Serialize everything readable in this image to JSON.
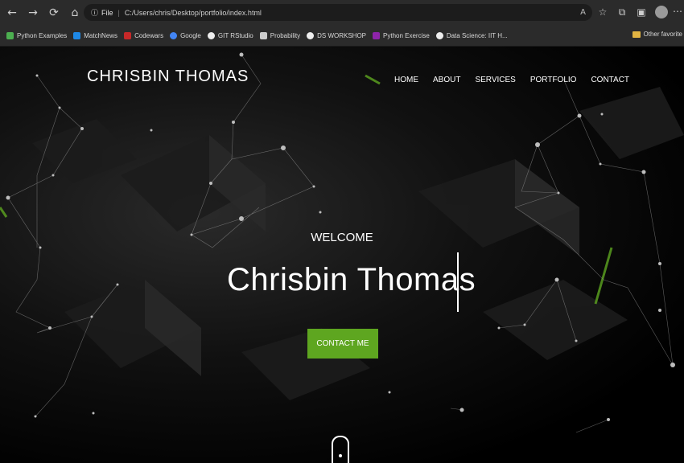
{
  "browser": {
    "back_icon": "←",
    "forward_icon": "→",
    "reload_icon": "⟳",
    "home_icon": "⌂",
    "info_icon": "ⓘ",
    "scheme": "File",
    "url": "C:/Users/chris/Desktop/portfolio/index.html",
    "bookmarks": [
      {
        "label": "Python Examples",
        "color": "#4caf50"
      },
      {
        "label": "MatchNews",
        "color": "#1e88e5"
      },
      {
        "label": "Codewars",
        "color": "#c62828"
      },
      {
        "label": "Google",
        "color": "#4285f4"
      },
      {
        "label": "GIT RStudio",
        "color": "#eeeeee"
      },
      {
        "label": "Probability",
        "color": "#cccccc"
      },
      {
        "label": "DS WORKSHOP",
        "color": "#eeeeee"
      },
      {
        "label": "Python Exercise",
        "color": "#8e24aa"
      },
      {
        "label": "Data Science: IIT H...",
        "color": "#eeeeee"
      }
    ],
    "other_favorites": "Other favorite"
  },
  "site": {
    "brand": "CHRISBIN THOMAS",
    "nav": [
      "HOME",
      "ABOUT",
      "SERVICES",
      "PORTFOLIO",
      "CONTACT"
    ],
    "welcome": "WELCOME",
    "hero_name": "Chrisbin Thomas",
    "cta_label": "CONTACT ME",
    "accent_color": "#5ea620"
  }
}
